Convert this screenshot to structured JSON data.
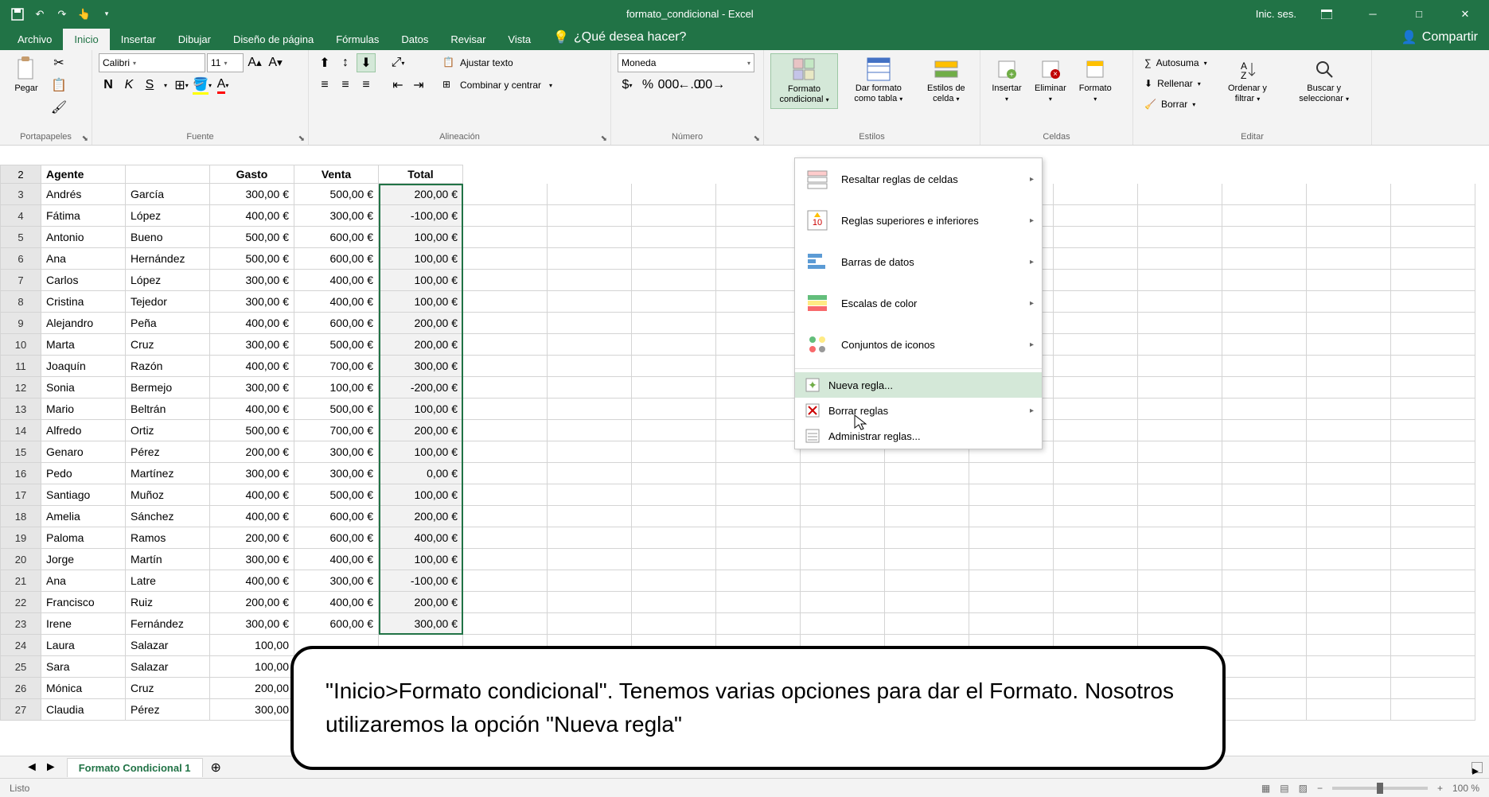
{
  "app": {
    "title": "formato_condicional - Excel",
    "signin": "Inic. ses.",
    "share": "Compartir",
    "tell_me": "¿Qué desea hacer?"
  },
  "tabs": {
    "archivo": "Archivo",
    "inicio": "Inicio",
    "insertar": "Insertar",
    "dibujar": "Dibujar",
    "diseno": "Diseño de página",
    "formulas": "Fórmulas",
    "datos": "Datos",
    "revisar": "Revisar",
    "vista": "Vista"
  },
  "ribbon": {
    "clipboard": {
      "label": "Portapapeles",
      "paste": "Pegar"
    },
    "font": {
      "label": "Fuente",
      "family": "Calibri",
      "size": "11"
    },
    "alignment": {
      "label": "Alineación",
      "wrap": "Ajustar texto",
      "merge": "Combinar y centrar"
    },
    "number": {
      "label": "Número",
      "format": "Moneda"
    },
    "styles": {
      "cf": "Formato condicional",
      "table": "Dar formato como tabla",
      "cell": "Estilos de celda"
    },
    "cells": {
      "label": "Celdas",
      "insert": "Insertar",
      "delete": "Eliminar",
      "format": "Formato"
    },
    "editing": {
      "label": "Editar",
      "autosum": "Autosuma",
      "fill": "Rellenar",
      "clear": "Borrar",
      "sort": "Ordenar y filtrar",
      "find": "Buscar y seleccionar"
    }
  },
  "cf_menu": {
    "highlight": "Resaltar reglas de celdas",
    "toprules": "Reglas superiores e inferiores",
    "databars": "Barras de datos",
    "colorscales": "Escalas de color",
    "iconsets": "Conjuntos de iconos",
    "newrule": "Nueva regla...",
    "clearrules": "Borrar reglas",
    "managerules": "Administrar reglas..."
  },
  "headers": {
    "a": "Agente",
    "b": "",
    "c": "Gasto",
    "d": "Venta",
    "e": "Total"
  },
  "rows": [
    {
      "n": 3,
      "a": "Andrés",
      "b": "García",
      "c": "300,00 €",
      "d": "500,00 €",
      "e": "200,00 €"
    },
    {
      "n": 4,
      "a": "Fátima",
      "b": "López",
      "c": "400,00 €",
      "d": "300,00 €",
      "e": "-100,00 €"
    },
    {
      "n": 5,
      "a": "Antonio",
      "b": "Bueno",
      "c": "500,00 €",
      "d": "600,00 €",
      "e": "100,00 €"
    },
    {
      "n": 6,
      "a": "Ana",
      "b": "Hernández",
      "c": "500,00 €",
      "d": "600,00 €",
      "e": "100,00 €"
    },
    {
      "n": 7,
      "a": "Carlos",
      "b": "López",
      "c": "300,00 €",
      "d": "400,00 €",
      "e": "100,00 €"
    },
    {
      "n": 8,
      "a": "Cristina",
      "b": "Tejedor",
      "c": "300,00 €",
      "d": "400,00 €",
      "e": "100,00 €"
    },
    {
      "n": 9,
      "a": "Alejandro",
      "b": "Peña",
      "c": "400,00 €",
      "d": "600,00 €",
      "e": "200,00 €"
    },
    {
      "n": 10,
      "a": "Marta",
      "b": "Cruz",
      "c": "300,00 €",
      "d": "500,00 €",
      "e": "200,00 €"
    },
    {
      "n": 11,
      "a": "Joaquín",
      "b": "Razón",
      "c": "400,00 €",
      "d": "700,00 €",
      "e": "300,00 €"
    },
    {
      "n": 12,
      "a": "Sonia",
      "b": "Bermejo",
      "c": "300,00 €",
      "d": "100,00 €",
      "e": "-200,00 €"
    },
    {
      "n": 13,
      "a": "Mario",
      "b": "Beltrán",
      "c": "400,00 €",
      "d": "500,00 €",
      "e": "100,00 €"
    },
    {
      "n": 14,
      "a": "Alfredo",
      "b": "Ortiz",
      "c": "500,00 €",
      "d": "700,00 €",
      "e": "200,00 €"
    },
    {
      "n": 15,
      "a": "Genaro",
      "b": "Pérez",
      "c": "200,00 €",
      "d": "300,00 €",
      "e": "100,00 €"
    },
    {
      "n": 16,
      "a": "Pedo",
      "b": "Martínez",
      "c": "300,00 €",
      "d": "300,00 €",
      "e": "0,00 €"
    },
    {
      "n": 17,
      "a": "Santiago",
      "b": "Muñoz",
      "c": "400,00 €",
      "d": "500,00 €",
      "e": "100,00 €"
    },
    {
      "n": 18,
      "a": "Amelia",
      "b": "Sánchez",
      "c": "400,00 €",
      "d": "600,00 €",
      "e": "200,00 €"
    },
    {
      "n": 19,
      "a": "Paloma",
      "b": "Ramos",
      "c": "200,00 €",
      "d": "600,00 €",
      "e": "400,00 €"
    },
    {
      "n": 20,
      "a": "Jorge",
      "b": "Martín",
      "c": "300,00 €",
      "d": "400,00 €",
      "e": "100,00 €"
    },
    {
      "n": 21,
      "a": "Ana",
      "b": "Latre",
      "c": "400,00 €",
      "d": "300,00 €",
      "e": "-100,00 €"
    },
    {
      "n": 22,
      "a": "Francisco",
      "b": "Ruiz",
      "c": "200,00 €",
      "d": "400,00 €",
      "e": "200,00 €"
    },
    {
      "n": 23,
      "a": "Irene",
      "b": "Fernández",
      "c": "300,00 €",
      "d": "600,00 €",
      "e": "300,00 €"
    },
    {
      "n": 24,
      "a": "Laura",
      "b": "Salazar",
      "c": "100,00",
      "d": "",
      "e": ""
    },
    {
      "n": 25,
      "a": "Sara",
      "b": "Salazar",
      "c": "100,00",
      "d": "",
      "e": ""
    },
    {
      "n": 26,
      "a": "Mónica",
      "b": "Cruz",
      "c": "200,00",
      "d": "",
      "e": ""
    },
    {
      "n": 27,
      "a": "Claudia",
      "b": "Pérez",
      "c": "300,00",
      "d": "",
      "e": ""
    }
  ],
  "sheet": {
    "tab": "Formato Condicional 1"
  },
  "status": {
    "ready": "Listo",
    "zoom": "100 %"
  },
  "annotation": "\"Inicio>Formato condicional\". Tenemos varias opciones para dar el Formato. Nosotros utilizaremos la opción \"Nueva regla\""
}
